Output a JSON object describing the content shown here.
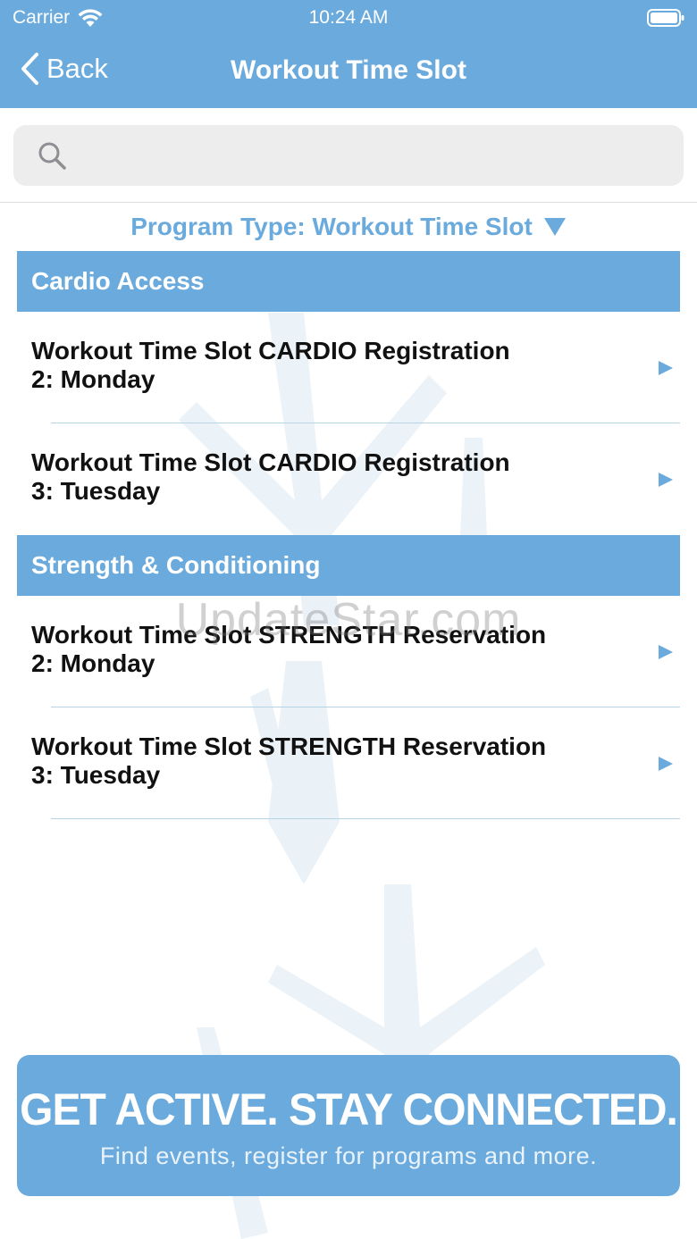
{
  "status_bar": {
    "carrier": "Carrier",
    "time": "10:24 AM"
  },
  "nav": {
    "back_label": "Back",
    "title": "Workout Time Slot"
  },
  "search": {
    "placeholder": "",
    "value": ""
  },
  "filter": {
    "label": "Program Type: Workout Time Slot"
  },
  "sections": [
    {
      "title": "Cardio Access",
      "items": [
        {
          "line1": "Workout Time Slot CARDIO Registration",
          "line2": "2: Monday"
        },
        {
          "line1": "Workout Time Slot CARDIO Registration",
          "line2": "3: Tuesday"
        }
      ]
    },
    {
      "title": "Strength & Conditioning",
      "items": [
        {
          "line1": "Workout Time Slot STRENGTH Reservation",
          "line2": "2: Monday"
        },
        {
          "line1": "Workout Time Slot STRENGTH Reservation",
          "line2": "3: Tuesday"
        }
      ]
    }
  ],
  "watermark": "UpdateStar.com",
  "banner": {
    "title": "GET ACTIVE.  STAY CONNECTED.",
    "subtitle": "Find events, register for programs and more."
  },
  "colors": {
    "accent": "#6aaadc",
    "divider": "#b7d3e6",
    "search_bg": "#ededed"
  },
  "icons": [
    "wifi-icon",
    "battery-icon",
    "back-chevron-icon",
    "search-icon",
    "triangle-down-icon",
    "row-arrow-icon"
  ]
}
